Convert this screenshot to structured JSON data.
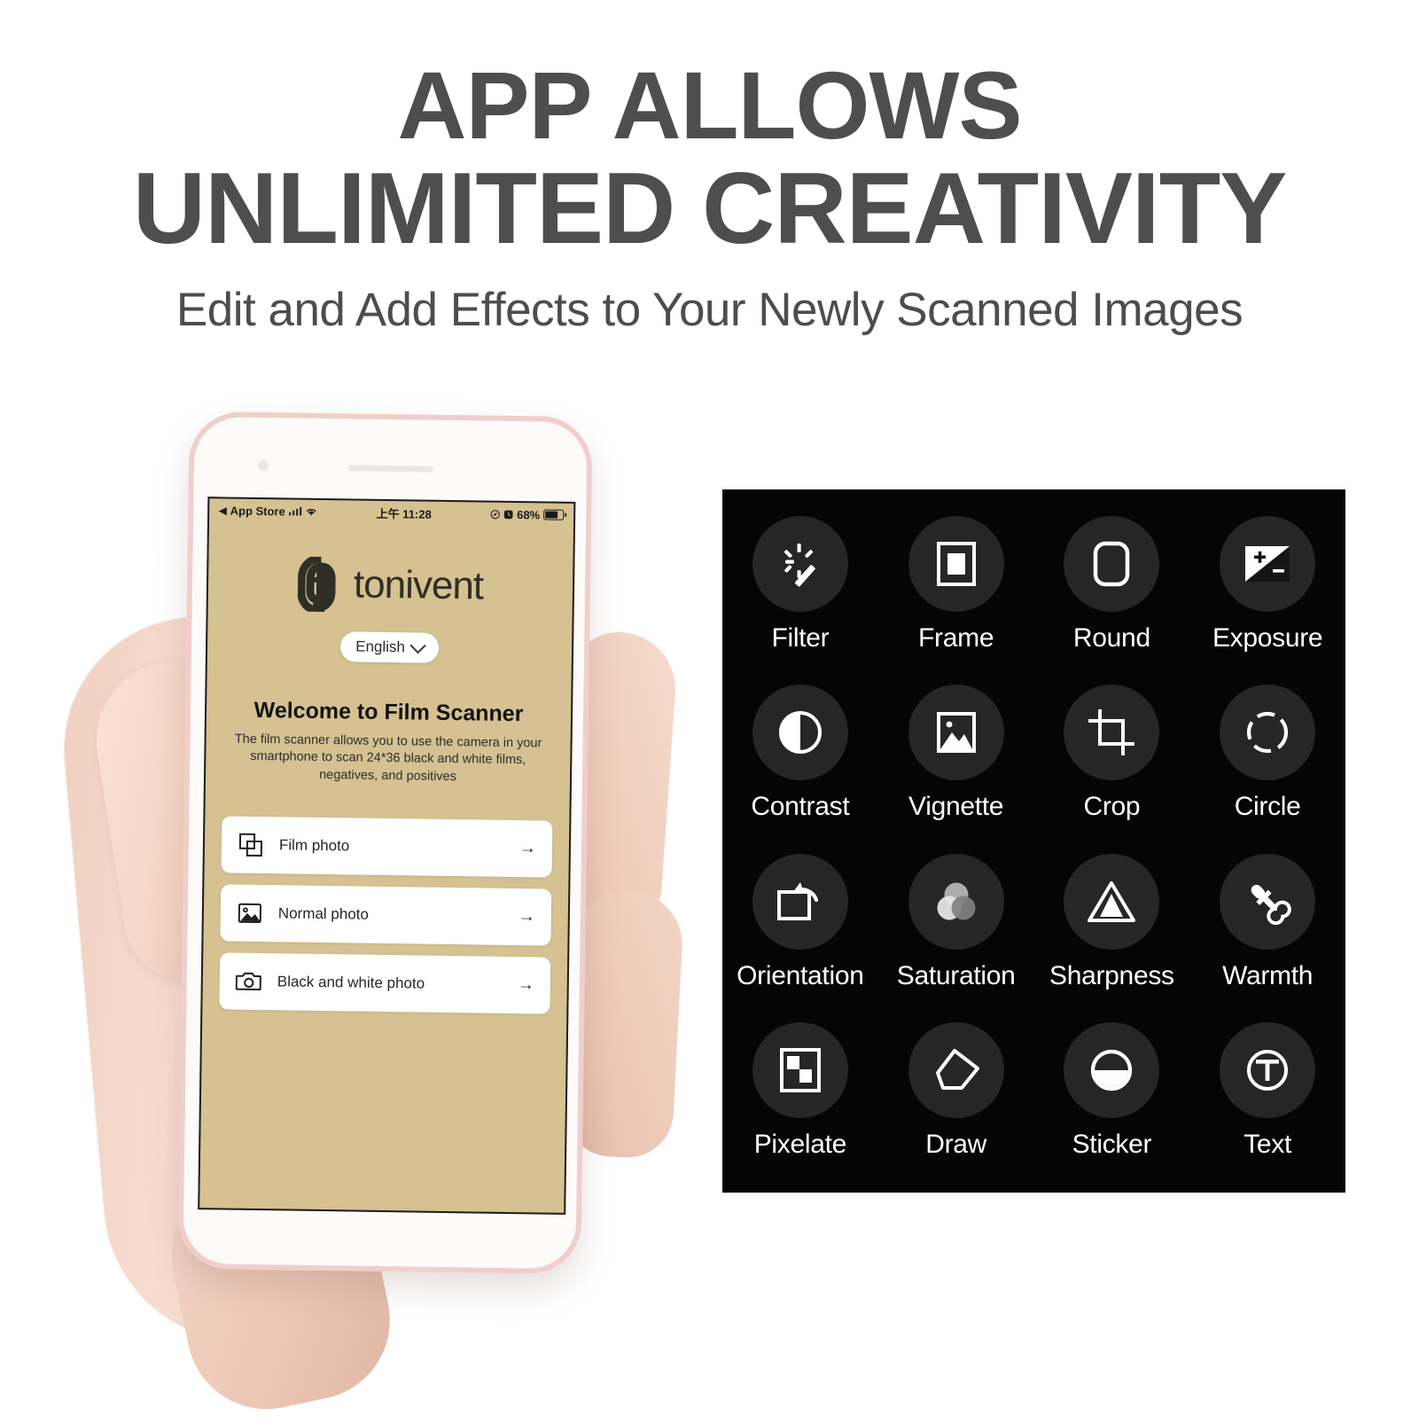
{
  "header": {
    "headline_line1": "APP ALLOWS",
    "headline_line2": "UNLIMITED CREATIVITY",
    "subheadline": "Edit and Add Effects to Your Newly Scanned Images",
    "text_color": "#4d4d4d"
  },
  "phone": {
    "status_bar": {
      "back_app": "App Store",
      "signal_icon": "cellular-bars-icon",
      "wifi_icon": "wifi-icon",
      "time": "上午 11:28",
      "location_icon": "location-arrow-icon",
      "alarm_icon": "alarm-clock-icon",
      "battery_percent": "68%",
      "battery_icon": "battery-icon"
    },
    "screen_bg_color": "#d5c191",
    "brand": {
      "logo_icon": "tonivent-logo-mark",
      "wordmark": "tonivent",
      "logo_color": "#2f2f25"
    },
    "language_selector": {
      "value": "English",
      "chevron_icon": "chevron-down-icon"
    },
    "welcome_title": "Welcome to Film Scanner",
    "description": "The film scanner allows you to use the camera in your smartphone to scan 24*36 black and white films, negatives, and positives",
    "options": [
      {
        "label": "Film photo",
        "icon": "overlapping-squares-icon",
        "arrow": "→"
      },
      {
        "label": "Normal photo",
        "icon": "picture-mountain-icon",
        "arrow": "→"
      },
      {
        "label": "Black and white photo",
        "icon": "camera-icon",
        "arrow": "→"
      }
    ]
  },
  "edit_panel": {
    "background_color": "#050505",
    "bubble_color": "#262626",
    "label_color": "#ffffff",
    "tools": [
      {
        "label": "Filter",
        "icon": "magic-wand-icon"
      },
      {
        "label": "Frame",
        "icon": "frame-square-icon"
      },
      {
        "label": "Round",
        "icon": "rounded-rect-icon"
      },
      {
        "label": "Exposure",
        "icon": "exposure-plus-minus-icon"
      },
      {
        "label": "Contrast",
        "icon": "contrast-half-circle-icon"
      },
      {
        "label": "Vignette",
        "icon": "picture-mountain-icon"
      },
      {
        "label": "Crop",
        "icon": "crop-marks-icon"
      },
      {
        "label": "Circle",
        "icon": "dashed-circle-icon"
      },
      {
        "label": "Orientation",
        "icon": "rotate-square-icon"
      },
      {
        "label": "Saturation",
        "icon": "three-circles-icon"
      },
      {
        "label": "Sharpness",
        "icon": "triangle-icon"
      },
      {
        "label": "Warmth",
        "icon": "eyedropper-icon"
      },
      {
        "label": "Pixelate",
        "icon": "checkerboard-icon"
      },
      {
        "label": "Draw",
        "icon": "pencil-tag-icon"
      },
      {
        "label": "Sticker",
        "icon": "half-filled-circle-icon"
      },
      {
        "label": "Text",
        "icon": "text-circle-t-icon"
      }
    ]
  }
}
